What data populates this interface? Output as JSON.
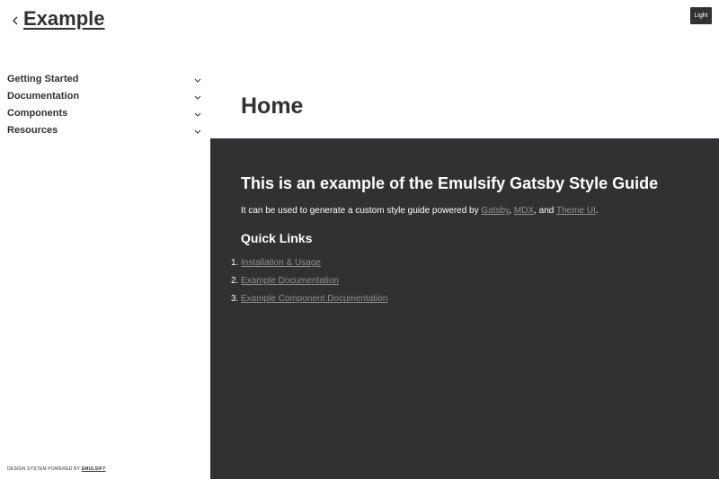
{
  "header": {
    "back_icon": "chevron-left-icon",
    "site_title": "Example",
    "mode_button_label": "Light"
  },
  "sidebar": {
    "items": [
      {
        "label": "Getting Started",
        "icon": "chevron-down-icon"
      },
      {
        "label": "Documentation",
        "icon": "chevron-down-icon"
      },
      {
        "label": "Components",
        "icon": "chevron-down-icon"
      },
      {
        "label": "Resources",
        "icon": "chevron-down-icon"
      }
    ],
    "footer": {
      "text": "DESIGN SYSTEM POWERED BY",
      "link": "EMULSIFY"
    }
  },
  "main": {
    "page_title": "Home",
    "heading": "This is an example of the Emulsify Gatsby Style Guide",
    "intro": {
      "prefix": "It can be used to generate a custom style guide powered by ",
      "link1": "Gatsby",
      "sep1": ", ",
      "link2": "MDX",
      "sep2": ", and ",
      "link3": "Theme UI",
      "suffix": "."
    },
    "quick_links_heading": "Quick Links",
    "quick_links": [
      {
        "num": "1.",
        "label": "Installation & Usage"
      },
      {
        "num": "2.",
        "label": "Example Documentation"
      },
      {
        "num": "3.",
        "label": "Example Component Documentation"
      }
    ]
  },
  "colors": {
    "dark_bg": "#2f3133",
    "text": "#2f3133",
    "link_muted": "#8e8f91",
    "white": "#ffffff"
  }
}
